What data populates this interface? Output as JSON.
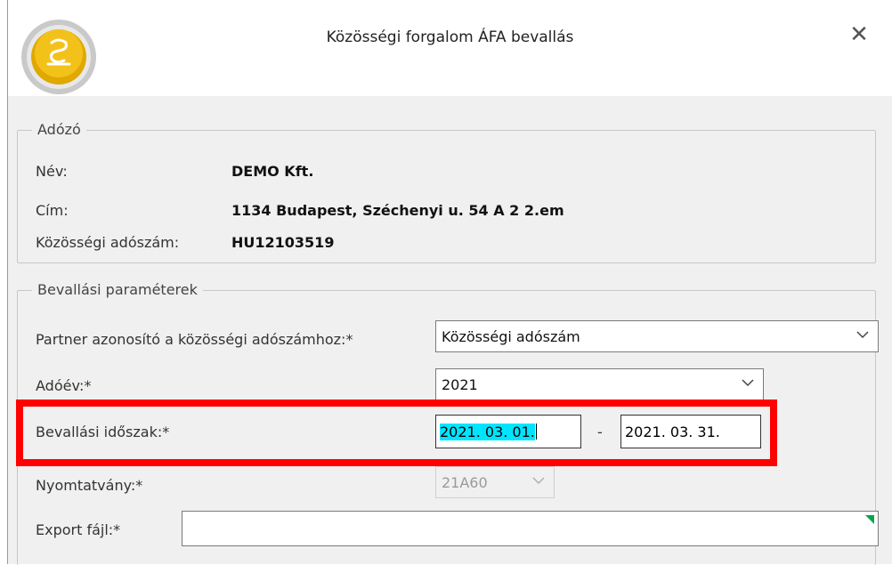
{
  "window": {
    "title": "Közösségi forgalom ÁFA bevallás",
    "close_symbol": "✕"
  },
  "adozo": {
    "legend": "Adózó",
    "nev_label": "Név:",
    "nev_value": "DEMO Kft.",
    "cim_label": "Cím:",
    "cim_value": "1134 Budapest, Széchenyi u. 54 A 2 2.em",
    "adoszam_label": "Közösségi adószám:",
    "adoszam_value": "HU12103519"
  },
  "params": {
    "legend": "Bevallási paraméterek",
    "partner_label": "Partner azonosító a közösségi adószámhoz:*",
    "partner_value": "Közösségi adószám",
    "adoev_label": "Adóév:*",
    "adoev_value": "2021",
    "idoszak_label": "Bevallási időszak:*",
    "idoszak_from": "2021. 03. 01.",
    "idoszak_separator": "-",
    "idoszak_to": "2021. 03. 31.",
    "nyomtatvany_label": "Nyomtatvány:*",
    "nyomtatvany_value": "21A60",
    "export_label": "Export fájl:*",
    "export_value": ""
  },
  "colors": {
    "highlight_frame": "#ff0000",
    "selection": "#00e5ff",
    "required_marker": "#00a650"
  }
}
